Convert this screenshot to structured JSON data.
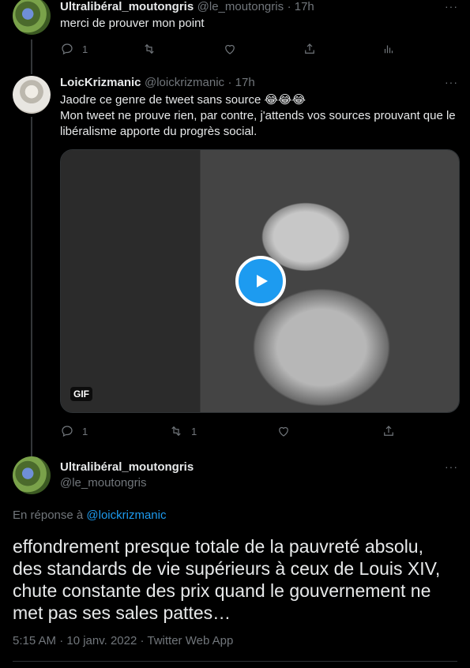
{
  "tweet1": {
    "name": "Ultralibéral_moutongris",
    "handle": "@le_moutongris",
    "time": "· 17h",
    "text": "merci de prouver mon point",
    "reply_count": "1",
    "more": "···"
  },
  "tweet2": {
    "name": "LoicKrizmanic",
    "handle": "@loickrizmanic",
    "time": "· 17h",
    "line1": "Jaodre ce genre de tweet sans source 😂😂😂",
    "line2": "Mon tweet ne prouve rien, par contre, j'attends vos sources prouvant que le",
    "line3": "libéralisme apporte du progrès social.",
    "gif_label": "GIF",
    "reply_count": "1",
    "retweet_count": "1",
    "more": "···"
  },
  "main_tweet": {
    "name": "Ultralibéral_moutongris",
    "handle": "@le_moutongris",
    "reply_prefix": "En réponse à",
    "reply_to": "@loickrizmanic",
    "line1": "effondrement presque totale de la pauvreté absolu,",
    "line2": "des standards de vie supérieurs à ceux de Louis XIV,",
    "line3": "chute constante des prix quand le gouvernement ne",
    "line4": "met pas ses sales pattes…",
    "meta": "5:15 AM · 10 janv. 2022 · Twitter Web App",
    "more": "···"
  },
  "colors": {
    "background": "#000000",
    "text": "#e7e9ea",
    "muted": "#71767b",
    "accent": "#1d9bf0",
    "border": "#2f3336"
  },
  "icons": [
    "reply-icon",
    "retweet-icon",
    "like-icon",
    "share-icon",
    "analytics-icon",
    "play-icon"
  ]
}
